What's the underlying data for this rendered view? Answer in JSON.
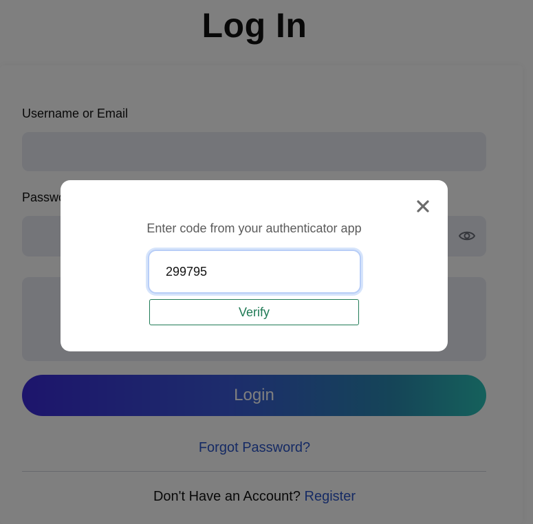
{
  "page": {
    "title": "Log In"
  },
  "login_form": {
    "username_label": "Username or Email",
    "username_value": "",
    "password_label": "Password",
    "password_value": "",
    "login_button_label": "Login",
    "forgot_password_label": "Forgot Password?",
    "no_account_text": "Don't Have an Account?",
    "register_label": "Register"
  },
  "mfa_modal": {
    "prompt": "Enter code from your authenticator app",
    "code_value": "299795",
    "verify_label": "Verify",
    "close_icon": "close-icon"
  },
  "colors": {
    "link": "#2a55c8",
    "verify_accent": "#1f7a55",
    "input_background": "#e8eaf3",
    "login_gradient_start": "#3a2ad8",
    "login_gradient_end": "#2ac2b8"
  },
  "icons": {
    "password_toggle": "eye-icon"
  }
}
